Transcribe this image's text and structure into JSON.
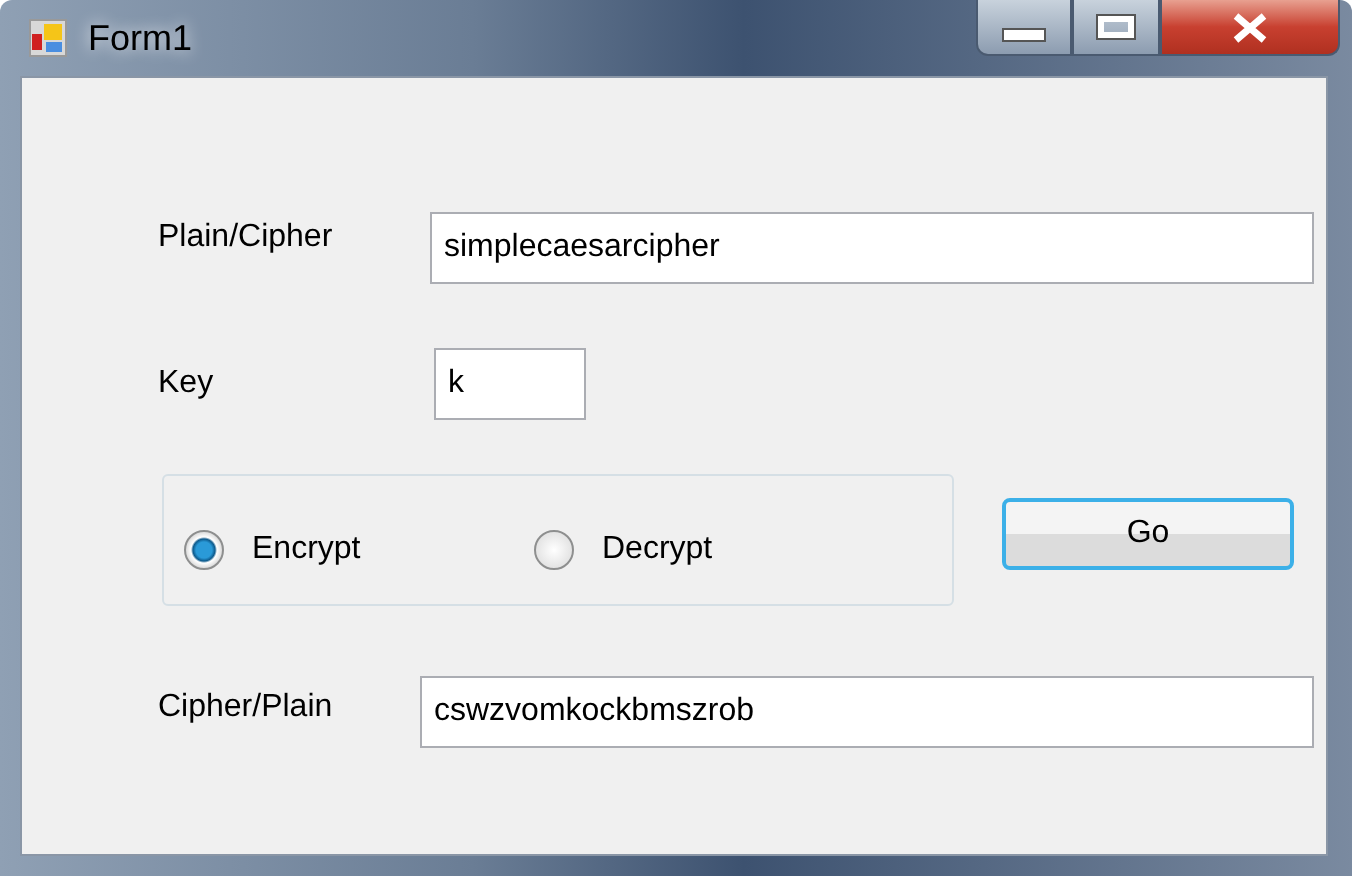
{
  "window": {
    "title": "Form1"
  },
  "plain_field": {
    "label": "Plain/Cipher",
    "value": "simplecaesarcipher"
  },
  "key_field": {
    "label": "Key",
    "value": "k"
  },
  "modes": [
    {
      "label": "Encrypt",
      "selected": true
    },
    {
      "label": "Decrypt",
      "selected": false
    }
  ],
  "go_button": {
    "label": "Go"
  },
  "cipher_field": {
    "label": "Cipher/Plain",
    "value": "cswzvomkockbmszrob"
  }
}
